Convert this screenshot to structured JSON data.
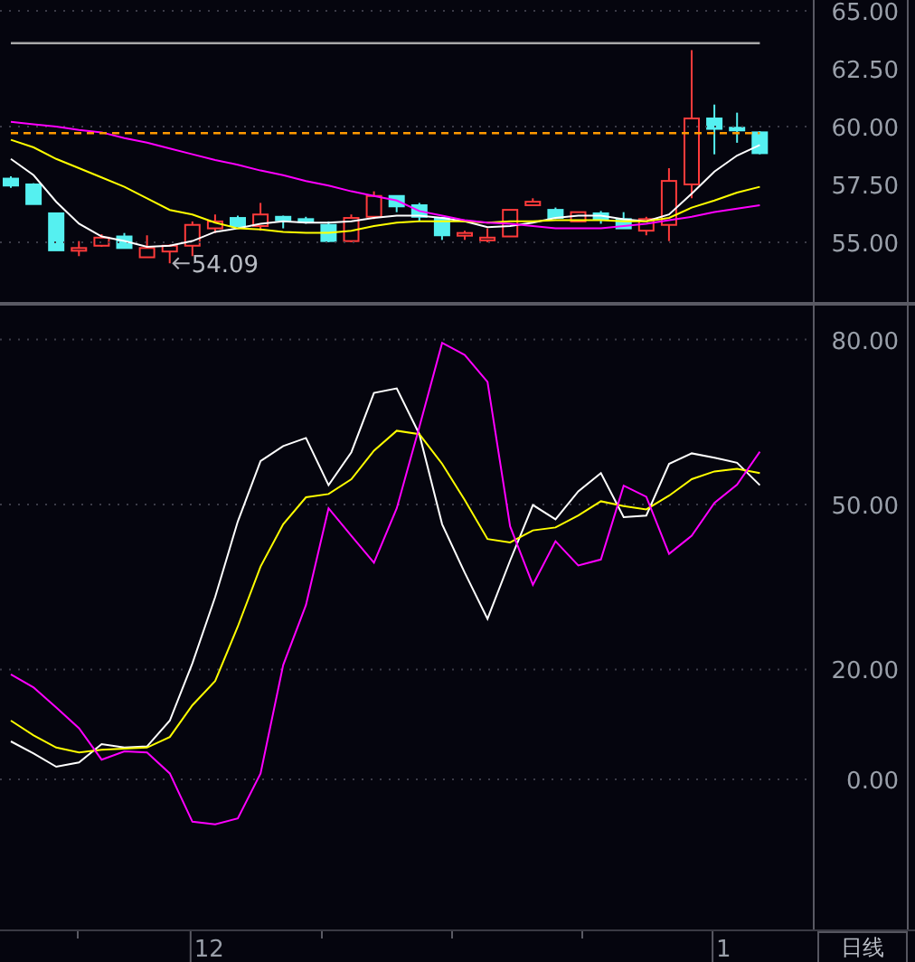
{
  "price_panel": {
    "chart_data": {
      "type": "candlestick",
      "ylim": [
        52.34,
        65.47
      ],
      "ohlc": [
        [
          57.75,
          57.85,
          57.35,
          57.45
        ],
        [
          57.5,
          57.55,
          56.65,
          56.65
        ],
        [
          56.25,
          56.25,
          54.65,
          54.65
        ],
        [
          54.7,
          55.05,
          54.4,
          54.75
        ],
        [
          54.85,
          55.35,
          54.8,
          55.2
        ],
        [
          55.25,
          55.4,
          54.75,
          54.75
        ],
        [
          54.35,
          55.3,
          54.35,
          54.75
        ],
        [
          54.6,
          54.9,
          54.09,
          54.85
        ],
        [
          54.85,
          55.9,
          54.4,
          55.75
        ],
        [
          55.6,
          56.2,
          55.4,
          55.9
        ],
        [
          56.05,
          56.15,
          55.65,
          55.7
        ],
        [
          55.7,
          56.7,
          55.5,
          56.2
        ],
        [
          56.1,
          56.15,
          55.6,
          55.95
        ],
        [
          56.0,
          56.1,
          55.8,
          55.95
        ],
        [
          55.75,
          55.9,
          55.0,
          55.05
        ],
        [
          55.05,
          56.2,
          55.0,
          56.05
        ],
        [
          56.1,
          57.2,
          56.0,
          57.0
        ],
        [
          57.0,
          57.0,
          56.3,
          56.55
        ],
        [
          56.6,
          56.7,
          55.9,
          56.1
        ],
        [
          56.05,
          56.1,
          55.1,
          55.3
        ],
        [
          55.3,
          55.5,
          55.1,
          55.4
        ],
        [
          55.1,
          55.6,
          55.0,
          55.2
        ],
        [
          55.25,
          56.4,
          55.25,
          56.4
        ],
        [
          56.6,
          56.9,
          56.6,
          56.75
        ],
        [
          56.4,
          56.5,
          56.0,
          56.05
        ],
        [
          55.9,
          56.3,
          55.9,
          56.3
        ],
        [
          56.25,
          56.35,
          55.8,
          56.0
        ],
        [
          56.0,
          56.3,
          55.6,
          55.6
        ],
        [
          55.5,
          56.1,
          55.3,
          56.0
        ],
        [
          55.75,
          58.2,
          55.05,
          57.65
        ],
        [
          57.5,
          63.3,
          56.9,
          60.35
        ],
        [
          60.35,
          60.95,
          58.8,
          59.9
        ],
        [
          59.95,
          60.6,
          59.3,
          59.85
        ],
        [
          59.75,
          59.8,
          58.8,
          58.85
        ]
      ],
      "annotations": [
        {
          "text": "54.09"
        }
      ]
    }
  },
  "moving_averages": {
    "chart_data": {
      "type": "line",
      "ylim": [
        52.34,
        65.47
      ],
      "grid": true,
      "yticks": [
        {
          "value": 55,
          "label": "55.00"
        },
        {
          "value": 57.5,
          "label": "57.50"
        },
        {
          "value": 60,
          "label": "60.00"
        },
        {
          "value": 62.5,
          "label": "62.50"
        },
        {
          "value": 65,
          "label": "65.00"
        }
      ],
      "series": [
        {
          "color": "#ffffff",
          "values": [
            58.6,
            57.9,
            56.75,
            55.8,
            55.25,
            55.05,
            54.8,
            54.85,
            55.05,
            55.45,
            55.6,
            55.8,
            55.9,
            55.85,
            55.85,
            55.9,
            56.05,
            56.15,
            56.15,
            56.05,
            55.9,
            55.65,
            55.7,
            55.85,
            56.05,
            56.15,
            56.15,
            56.0,
            55.9,
            56.2,
            57.1,
            58.05,
            58.75,
            59.2
          ]
        },
        {
          "color": "#ffff00",
          "values": [
            59.43,
            59.1,
            58.6,
            58.2,
            57.8,
            57.4,
            56.9,
            56.4,
            56.2,
            55.85,
            55.6,
            55.55,
            55.45,
            55.4,
            55.4,
            55.5,
            55.7,
            55.85,
            55.9,
            55.9,
            55.9,
            55.85,
            55.9,
            55.9,
            55.95,
            55.95,
            55.95,
            55.9,
            55.9,
            56.05,
            56.5,
            56.8,
            57.15,
            57.4
          ]
        },
        {
          "color": "#ff00ff",
          "values": [
            60.2,
            60.1,
            60.0,
            59.85,
            59.75,
            59.5,
            59.3,
            59.05,
            58.8,
            58.55,
            58.35,
            58.1,
            57.9,
            57.65,
            57.45,
            57.2,
            57.0,
            56.8,
            56.35,
            56.15,
            55.95,
            55.85,
            55.8,
            55.7,
            55.6,
            55.6,
            55.6,
            55.7,
            55.8,
            55.95,
            56.1,
            56.3,
            56.45,
            56.6
          ]
        },
        {
          "color": "#a8a8a8",
          "values": [
            63.6,
            63.6,
            63.6,
            63.6,
            63.6,
            63.6,
            63.6,
            63.6,
            63.6,
            63.6,
            63.6,
            63.6,
            63.6,
            63.6,
            63.6,
            63.6,
            63.6,
            63.6,
            63.6,
            63.6,
            63.6,
            63.6,
            63.6,
            63.6,
            63.6,
            63.6,
            63.6,
            63.6,
            63.6,
            63.6,
            63.6,
            63.6,
            63.6,
            63.6
          ]
        },
        {
          "color": "#ff9900",
          "line_style": "dashed",
          "values": [
            59.72,
            59.72,
            59.72,
            59.72,
            59.72,
            59.72,
            59.72,
            59.72,
            59.72,
            59.72,
            59.72,
            59.72,
            59.72,
            59.72,
            59.72,
            59.72,
            59.72,
            59.72,
            59.72,
            59.72,
            59.72,
            59.72,
            59.72,
            59.72,
            59.72,
            59.72,
            59.72,
            59.72,
            59.72,
            59.72,
            59.72,
            59.72,
            59.72,
            59.72
          ]
        }
      ]
    }
  },
  "indicator_panel": {
    "chart_data": {
      "type": "line",
      "ylim": [
        -27.3,
        86.5
      ],
      "grid": true,
      "yticks": [
        {
          "value": 0,
          "label": "0.00"
        },
        {
          "value": 20,
          "label": "20.00"
        },
        {
          "value": 50,
          "label": "50.00"
        },
        {
          "value": 80,
          "label": "80.00"
        }
      ],
      "series": [
        {
          "color": "#ffffff",
          "values": [
            6.9,
            4.7,
            2.3,
            3.1,
            6.4,
            5.8,
            6.0,
            10.7,
            21.1,
            33.2,
            46.9,
            57.9,
            60.6,
            62.1,
            53.5,
            59.5,
            70.3,
            71.1,
            62.8,
            46.4,
            37.6,
            29.2,
            39.8,
            49.9,
            47.3,
            52.4,
            55.7,
            47.7,
            48.0,
            57.4,
            59.3,
            58.5,
            57.6,
            53.5
          ]
        },
        {
          "color": "#ffff00",
          "values": [
            10.7,
            8.0,
            5.8,
            4.9,
            5.4,
            5.6,
            5.8,
            7.7,
            13.5,
            17.9,
            27.8,
            38.7,
            46.4,
            51.3,
            51.9,
            54.6,
            59.8,
            63.4,
            62.8,
            57.4,
            50.8,
            43.7,
            43.1,
            45.3,
            45.8,
            48.0,
            50.6,
            49.7,
            49.1,
            51.6,
            54.6,
            56.0,
            56.5,
            55.7
          ]
        },
        {
          "color": "#ff00ff",
          "values": [
            19.1,
            16.7,
            13.1,
            9.3,
            3.6,
            5.1,
            4.9,
            1.1,
            -7.7,
            -8.2,
            -7.1,
            1.1,
            20.8,
            31.7,
            49.3,
            44.3,
            39.4,
            49.3,
            64.1,
            79.4,
            77.2,
            72.3,
            46.0,
            35.4,
            43.3,
            38.9,
            40.0,
            53.4,
            51.4,
            41.0,
            44.3,
            50.3,
            53.6,
            59.6
          ]
        }
      ]
    }
  },
  "date_axis": [
    {
      "label": "12"
    },
    {
      "label": "1"
    }
  ],
  "period_button": {
    "label": "日线"
  }
}
